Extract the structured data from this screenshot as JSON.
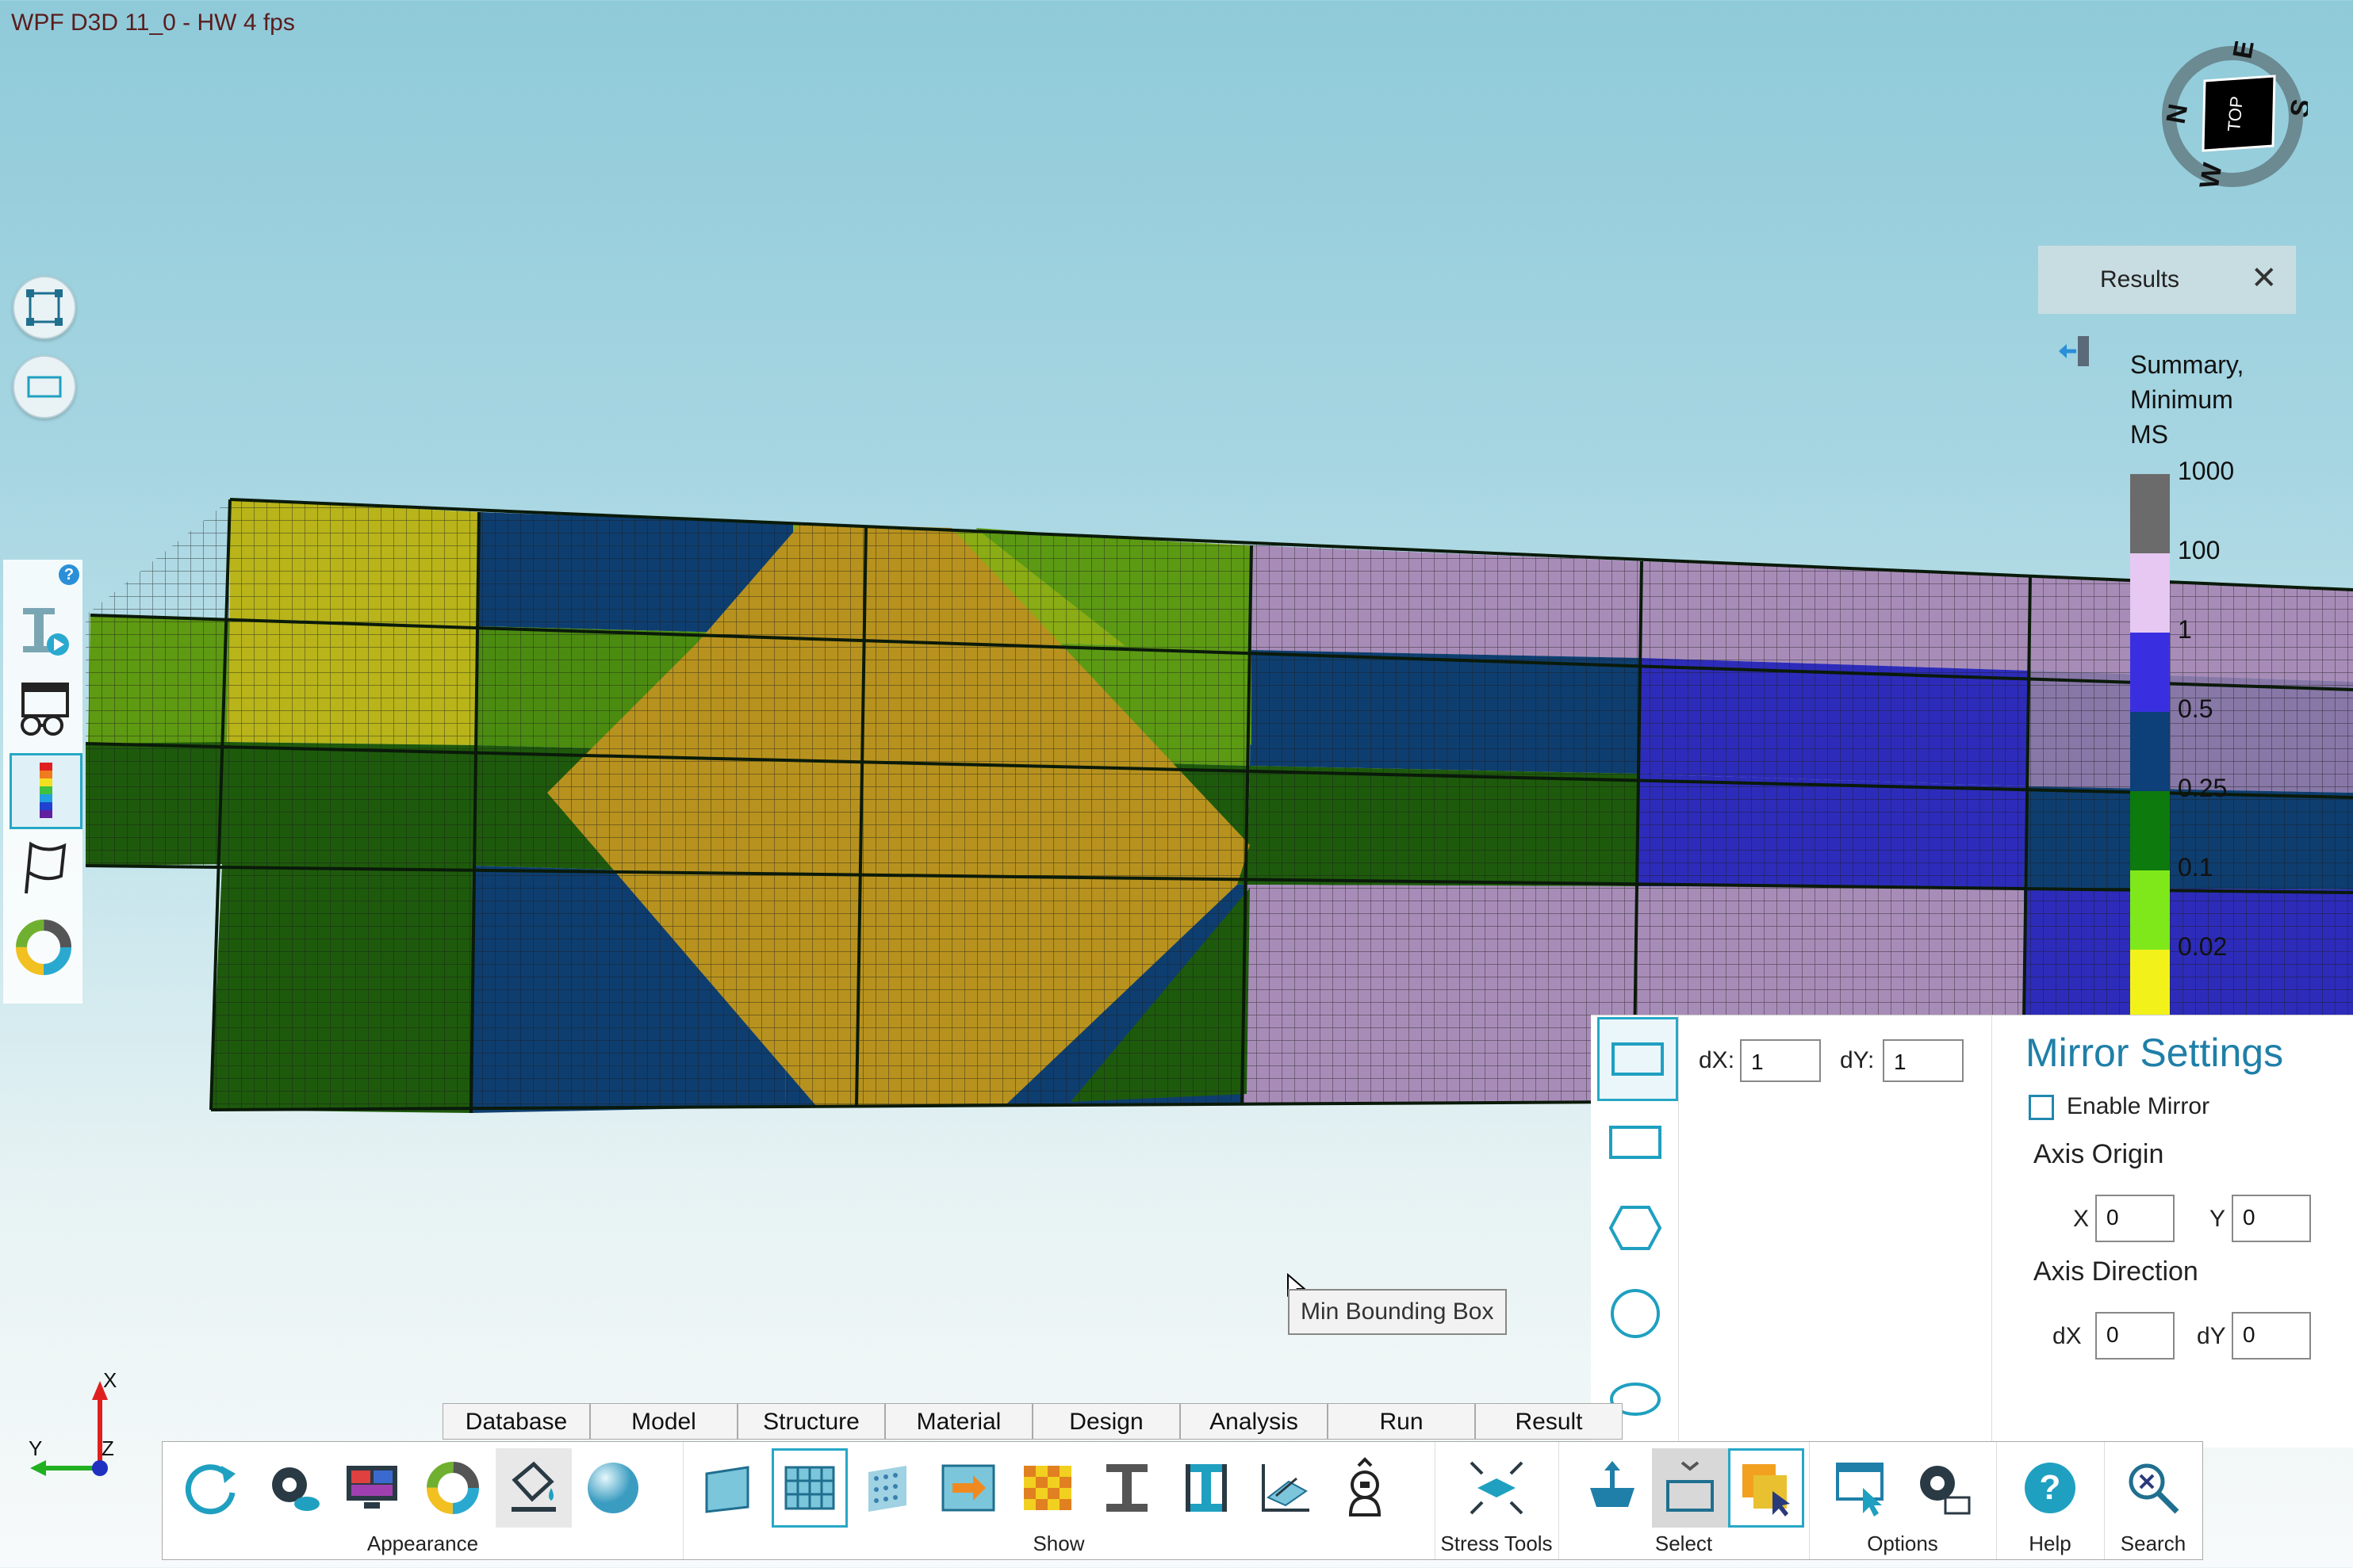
{
  "window": {
    "title": "WPF D3D 11_0 - HW  4  fps"
  },
  "left_buttons": [
    {
      "name": "zoom-extents"
    },
    {
      "name": "view-rectangle"
    }
  ],
  "left_toolbar": {
    "help": "?"
  },
  "results": {
    "title": "Results",
    "close": "✕",
    "summary_title": [
      "Summary,",
      "Minimum",
      "MS"
    ],
    "legend_labels": [
      "1000",
      "100",
      "1",
      "0.5",
      "0.25",
      "0.1",
      "0.02"
    ],
    "legend_colors": [
      "#6b6b6b",
      "#e6c8f2",
      "#3a2fe0",
      "#0d3f78",
      "#0d7a0d",
      "#7fe81a",
      "#f2f21a"
    ]
  },
  "compass": {
    "n": "N",
    "e": "E",
    "s": "S",
    "w": "W",
    "face": "TOP"
  },
  "panel": {
    "dx_label": "dX:",
    "dx_value": "1",
    "dy_label": "dY:",
    "dy_value": "1",
    "mirror_title": "Mirror Settings",
    "enable_mirror": "Enable Mirror",
    "axis_origin": "Axis Origin",
    "x_label": "X",
    "x_value": "0",
    "y_label": "Y",
    "y_value": "0",
    "axis_direction": "Axis Direction",
    "adx_label": "dX",
    "adx_value": "0",
    "ady_label": "dY",
    "ady_value": "0"
  },
  "tooltip": "Min Bounding Box",
  "tabs": [
    "Database",
    "Model",
    "Structure",
    "Material",
    "Design",
    "Analysis",
    "Run",
    "Result"
  ],
  "ribbon_groups": {
    "appearance": "Appearance",
    "show": "Show",
    "stress_tools": "Stress Tools",
    "select": "Select",
    "options": "Options",
    "help": "Help",
    "search": "Search"
  },
  "axes": {
    "x": "X",
    "y": "Y",
    "z": "Z"
  }
}
